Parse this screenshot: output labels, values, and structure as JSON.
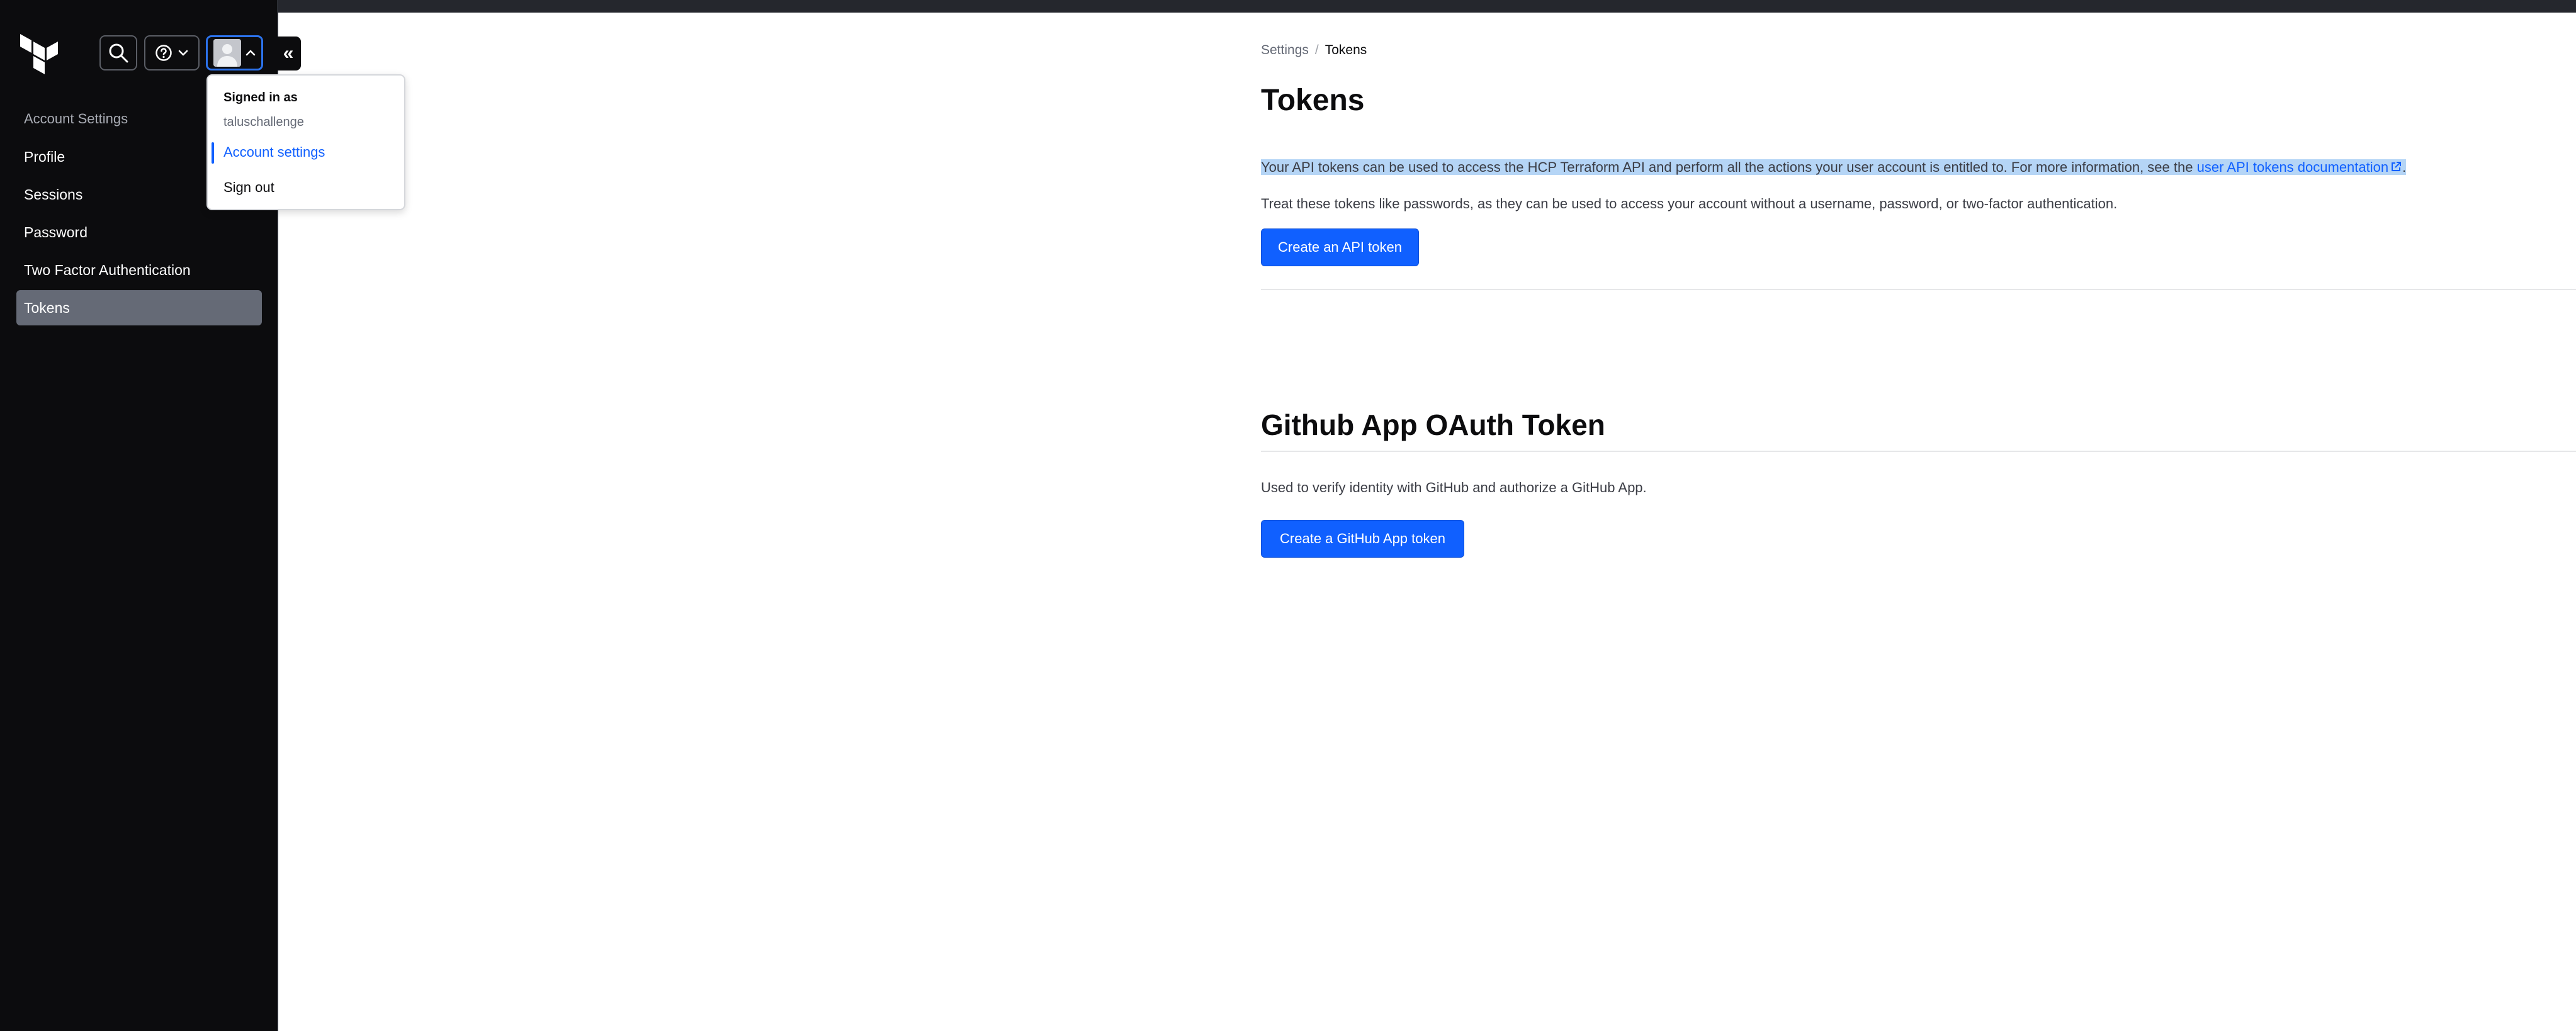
{
  "sidebar": {
    "heading": "Account Settings",
    "items": [
      {
        "label": "Profile"
      },
      {
        "label": "Sessions"
      },
      {
        "label": "Password"
      },
      {
        "label": "Two Factor Authentication"
      },
      {
        "label": "Tokens",
        "active": true
      }
    ],
    "collapse_glyph": "«"
  },
  "user_menu": {
    "signed_in_label": "Signed in as",
    "username": "taluschallenge",
    "account_settings": "Account settings",
    "sign_out": "Sign out"
  },
  "breadcrumb": {
    "parent": "Settings",
    "separator": "/",
    "current": "Tokens"
  },
  "main": {
    "title": "Tokens",
    "description_prefix": "Your API tokens can be used to access the HCP Terraform API and perform all the actions your user account is entitled to. For more information, see the ",
    "description_link": "user API tokens documentation",
    "description_suffix": ".",
    "warning": "Treat these tokens like passwords, as they can be used to access your account without a username, password, or two-factor authentication.",
    "create_api_token": "Create an API token",
    "github_title": "Github App OAuth Token",
    "github_description": "Used to verify identity with GitHub and authorize a GitHub App.",
    "create_github_token": "Create a GitHub App token"
  },
  "icons": [
    "terraform-logo-icon",
    "search-icon",
    "help-icon",
    "chevron-down-icon",
    "avatar",
    "chevron-up-icon",
    "external-link-icon"
  ],
  "colors": {
    "sidebar_bg": "#0c0c0e",
    "active_item": "#656a76",
    "primary": "#1060ff",
    "selection": "#b5d5f6"
  }
}
